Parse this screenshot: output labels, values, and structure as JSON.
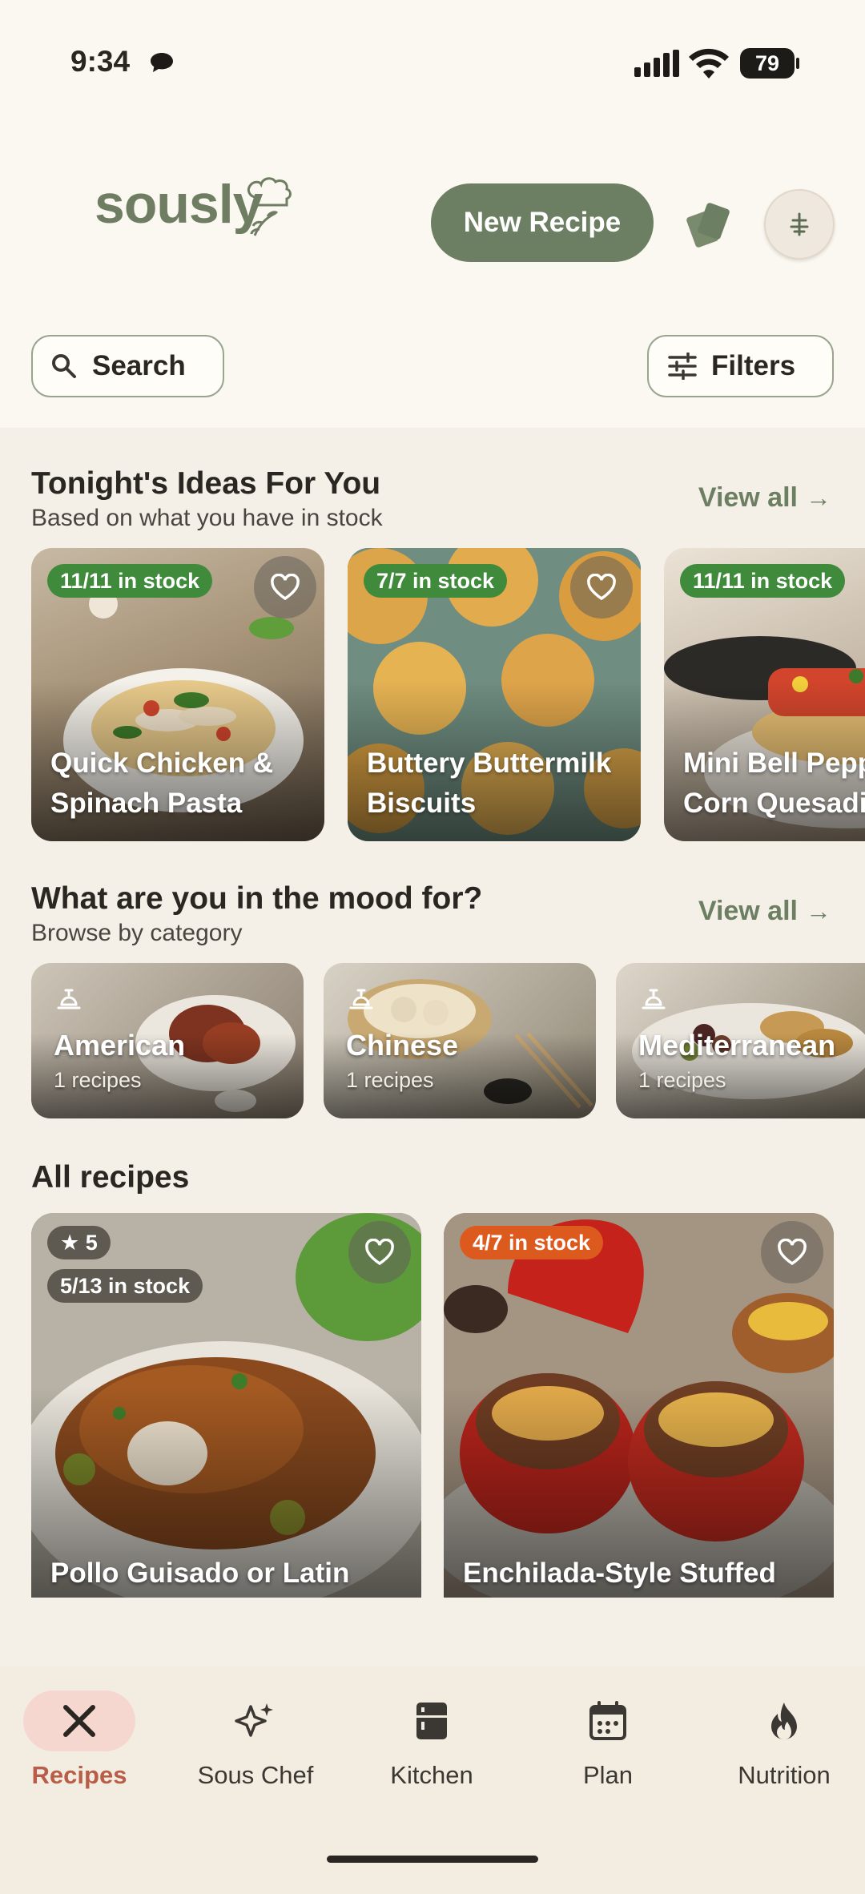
{
  "status_bar": {
    "time": "9:34",
    "battery": "79"
  },
  "header": {
    "logo_text": "sously",
    "new_recipe_label": "New Recipe",
    "search_label": "Search",
    "filters_label": "Filters"
  },
  "ideas": {
    "title": "Tonight's Ideas For You",
    "subtitle": "Based on what you have in stock",
    "view_all": "View all",
    "items": [
      {
        "name": "Quick Chicken &\nSpinach Pasta",
        "stock": "11/11 in stock"
      },
      {
        "name": "Buttery Buttermilk\nBiscuits",
        "stock": "7/7 in stock"
      },
      {
        "name": "Mini Bell Pepp\nCorn Quesadil",
        "stock": "11/11 in stock"
      }
    ]
  },
  "categories": {
    "title": "What are you in the mood for?",
    "subtitle": "Browse by category",
    "view_all": "View all",
    "items": [
      {
        "name": "American",
        "count": "1 recipes"
      },
      {
        "name": "Chinese",
        "count": "1 recipes"
      },
      {
        "name": "Mediterranean",
        "count": "1 recipes"
      }
    ]
  },
  "all_recipes": {
    "title": "All recipes",
    "items": [
      {
        "name": "Pollo Guisado or Latin",
        "rating": "5",
        "stock": "5/13 in stock"
      },
      {
        "name": "Enchilada-Style Stuffed",
        "stock": "4/7 in stock"
      }
    ]
  },
  "nav": {
    "items": [
      {
        "label": "Recipes",
        "icon": "utensils-icon",
        "active": true
      },
      {
        "label": "Sous Chef",
        "icon": "sparkles-icon"
      },
      {
        "label": "Kitchen",
        "icon": "fridge-icon"
      },
      {
        "label": "Plan",
        "icon": "calendar-icon"
      },
      {
        "label": "Nutrition",
        "icon": "flame-icon"
      }
    ]
  },
  "colors": {
    "brand_green": "#6d7f62",
    "in_stock_green": "#3f8a3b",
    "partial_stock_orange": "#dd5a1e",
    "nav_active": "#b85d47",
    "background": "#fbf8f1"
  }
}
